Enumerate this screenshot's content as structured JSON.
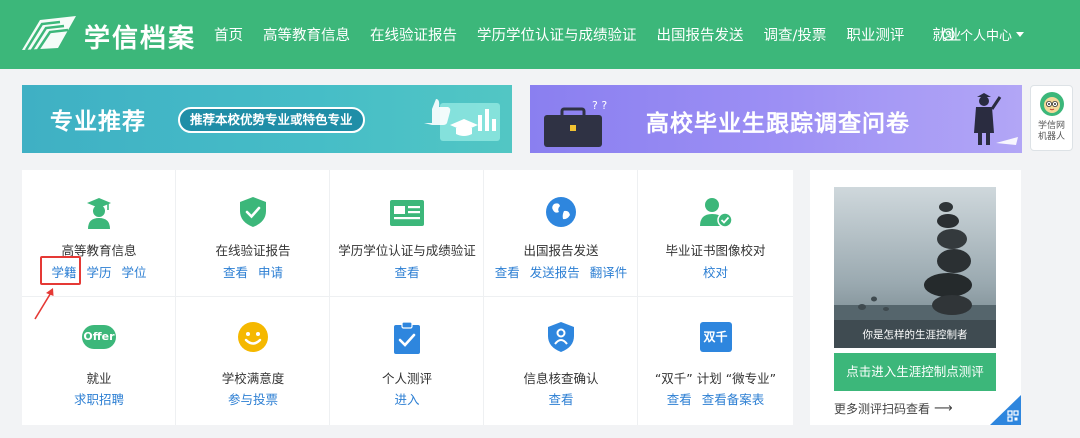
{
  "header": {
    "brand": "学信档案",
    "nav": [
      "首页",
      "高等教育信息",
      "在线验证报告",
      "学历学位认证与成绩验证",
      "出国报告发送",
      "调查/投票",
      "职业测评",
      "就业"
    ],
    "user_menu": "个人中心",
    "colors": {
      "header_bg": "#3cb77a",
      "link": "#2d7fd3",
      "highlight": "#e53935"
    }
  },
  "banners": {
    "left": {
      "title": "专业推荐",
      "pill": "推荐本校优势专业或特色专业"
    },
    "right": {
      "title": "高校毕业生跟踪调查问卷"
    }
  },
  "robot": {
    "label_line1": "学信网",
    "label_line2": "机器人"
  },
  "services": [
    {
      "title": "高等教育信息",
      "icon": "graduate-icon",
      "links": [
        "学籍",
        "学历",
        "学位"
      ]
    },
    {
      "title": "在线验证报告",
      "icon": "shield-check-icon",
      "links": [
        "查看",
        "申请"
      ]
    },
    {
      "title": "学历学位认证与成绩验证",
      "icon": "id-card-icon",
      "links": [
        "查看"
      ]
    },
    {
      "title": "出国报告发送",
      "icon": "globe-icon",
      "links": [
        "查看",
        "发送报告",
        "翻译件"
      ]
    },
    {
      "title": "毕业证书图像校对",
      "icon": "user-check-icon",
      "links": [
        "校对"
      ]
    },
    {
      "title": "就业",
      "icon": "offer-icon",
      "icon_text": "Offer",
      "links": [
        "求职招聘"
      ]
    },
    {
      "title": "学校满意度",
      "icon": "smiley-icon",
      "links": [
        "参与投票"
      ]
    },
    {
      "title": "个人测评",
      "icon": "clipboard-check-icon",
      "links": [
        "进入"
      ]
    },
    {
      "title": "信息核查确认",
      "icon": "shield-user-icon",
      "links": [
        "查看"
      ]
    },
    {
      "title": "“双千” 计划 “微专业”",
      "icon": "shuangqian-icon",
      "icon_text": "双千",
      "links": [
        "查看",
        "查看备案表"
      ]
    }
  ],
  "promo": {
    "caption": "你是怎样的生涯控制者",
    "button": "点击进入生涯控制点测评",
    "more": "更多测评扫码查看"
  }
}
